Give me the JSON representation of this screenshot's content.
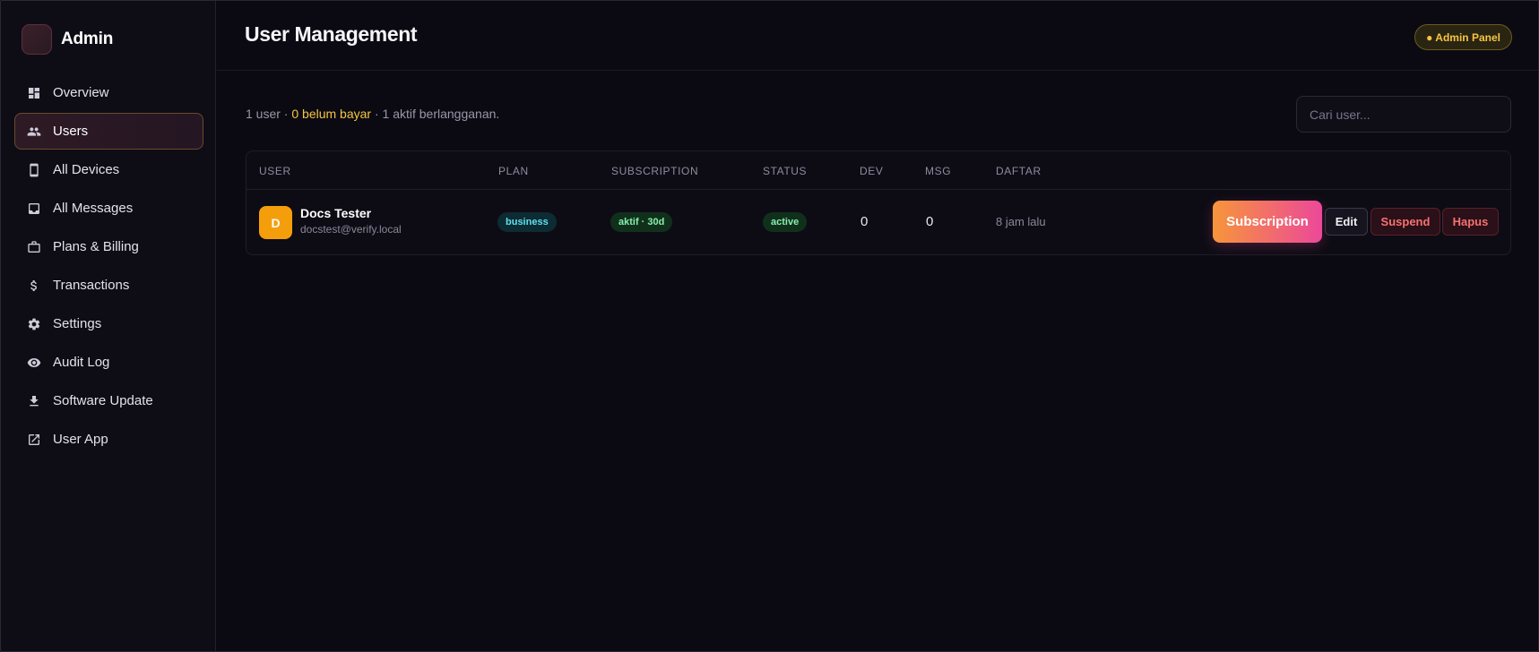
{
  "sidebar": {
    "brand": "Admin",
    "items": [
      {
        "label": "Overview",
        "icon": "dashboard-icon"
      },
      {
        "label": "Users",
        "icon": "users-icon",
        "active": true
      },
      {
        "label": "All Devices",
        "icon": "phone-icon"
      },
      {
        "label": "All Messages",
        "icon": "inbox-icon"
      },
      {
        "label": "Plans & Billing",
        "icon": "briefcase-icon"
      },
      {
        "label": "Transactions",
        "icon": "dollar-icon"
      },
      {
        "label": "Settings",
        "icon": "gear-icon"
      },
      {
        "label": "Audit Log",
        "icon": "eye-icon"
      },
      {
        "label": "Software Update",
        "icon": "download-icon"
      },
      {
        "label": "User App",
        "icon": "external-link-icon"
      }
    ]
  },
  "header": {
    "title": "User Management",
    "badge": "● Admin Panel"
  },
  "summary": {
    "users": "1 user · ",
    "unpaid": "0 belum bayar",
    "active": " · 1 aktif berlangganan."
  },
  "search": {
    "placeholder": "Cari user..."
  },
  "table": {
    "headers": [
      "USER",
      "PLAN",
      "SUBSCRIPTION",
      "STATUS",
      "DEV",
      "MSG",
      "DAFTAR"
    ],
    "rows": [
      {
        "initial": "D",
        "name": "Docs Tester",
        "email": "docstest@verify.local",
        "plan": "business",
        "subscription": "aktif · 30d",
        "status": "active",
        "dev": "0",
        "msg": "0",
        "daftar": "8 jam lalu",
        "actions": {
          "subscription": "Subscription",
          "edit": "Edit",
          "suspend": "Suspend",
          "hapus": "Hapus"
        }
      }
    ]
  },
  "colors": {
    "accent_gold": "#f5c542",
    "avatar": "#f59e0b",
    "plan_pill_text": "#5ee0f0",
    "status_green": "#86efac",
    "danger": "#f87171",
    "gradient_start": "#f7953a",
    "gradient_end": "#ec4899"
  }
}
